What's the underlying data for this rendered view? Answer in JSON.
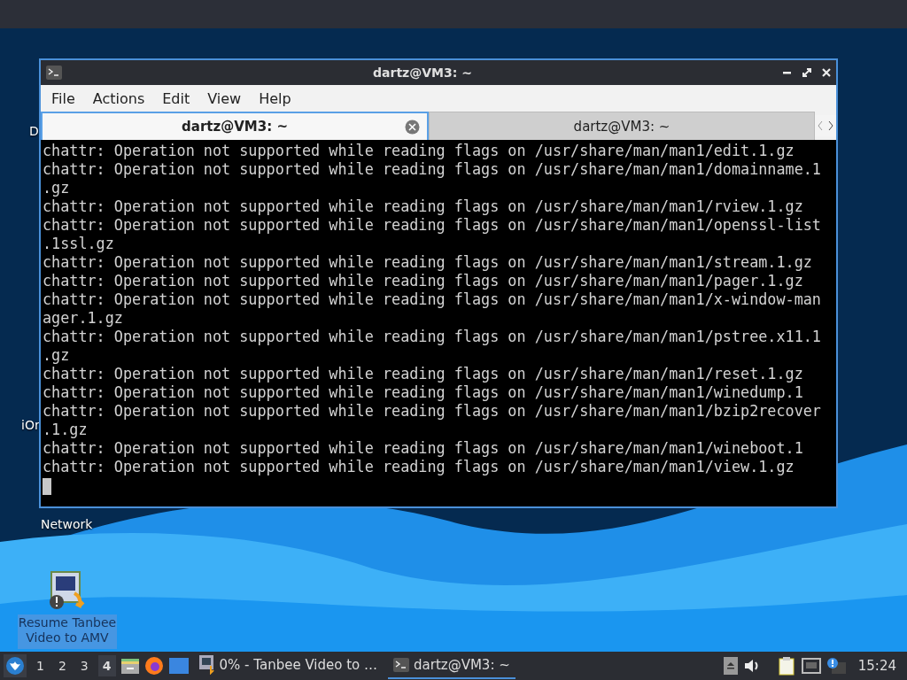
{
  "desktop": {
    "icons": [
      {
        "label": "D"
      },
      {
        "label": "iOr"
      },
      {
        "label": "Network"
      },
      {
        "label": "Resume Tanbee Video to AMV"
      }
    ]
  },
  "window": {
    "title": "dartz@VM3: ~",
    "menu": [
      "File",
      "Actions",
      "Edit",
      "View",
      "Help"
    ],
    "tabs": [
      {
        "label": "dartz@VM3: ~",
        "selected": true
      },
      {
        "label": "dartz@VM3: ~",
        "selected": false
      }
    ],
    "terminal_lines": [
      "chattr: Operation not supported while reading flags on /usr/share/man/man1/edit.1.gz",
      "chattr: Operation not supported while reading flags on /usr/share/man/man1/domainname.1",
      ".gz",
      "chattr: Operation not supported while reading flags on /usr/share/man/man1/rview.1.gz",
      "chattr: Operation not supported while reading flags on /usr/share/man/man1/openssl-list",
      ".1ssl.gz",
      "chattr: Operation not supported while reading flags on /usr/share/man/man1/stream.1.gz",
      "chattr: Operation not supported while reading flags on /usr/share/man/man1/pager.1.gz",
      "chattr: Operation not supported while reading flags on /usr/share/man/man1/x-window-man",
      "ager.1.gz",
      "chattr: Operation not supported while reading flags on /usr/share/man/man1/pstree.x11.1",
      ".gz",
      "chattr: Operation not supported while reading flags on /usr/share/man/man1/reset.1.gz",
      "chattr: Operation not supported while reading flags on /usr/share/man/man1/winedump.1",
      "chattr: Operation not supported while reading flags on /usr/share/man/man1/bzip2recover",
      ".1.gz",
      "chattr: Operation not supported while reading flags on /usr/share/man/man1/wineboot.1",
      "chattr: Operation not supported while reading flags on /usr/share/man/man1/view.1.gz"
    ]
  },
  "taskbar": {
    "workspaces": [
      {
        "label": "1",
        "selected": false
      },
      {
        "label": "2",
        "selected": false
      },
      {
        "label": "3",
        "selected": false
      },
      {
        "label": "4",
        "selected": true
      }
    ],
    "tasks": [
      {
        "label": "0% - Tanbee Video to …",
        "kind": "video",
        "selected": false
      },
      {
        "label": "dartz@VM3: ~",
        "kind": "terminal",
        "selected": true
      }
    ],
    "clock": "15:24"
  }
}
